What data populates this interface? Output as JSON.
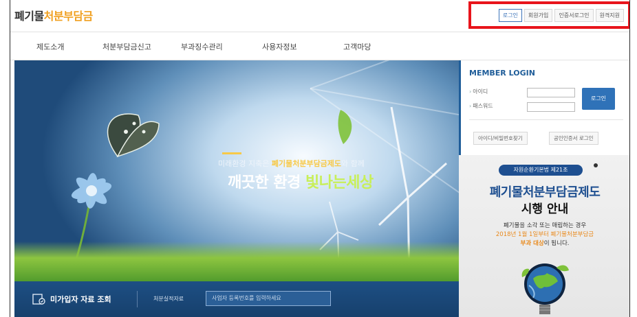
{
  "header": {
    "logo_part1": "폐기물",
    "logo_part2": "처분부담금"
  },
  "util_links": [
    "로그인",
    "회원가입",
    "인증서로그인",
    "원격지원"
  ],
  "nav": [
    "제도소개",
    "처분부담금신고",
    "부과징수관리",
    "사용자정보",
    "고객마당"
  ],
  "hero": {
    "line1_pre": "미래환경 지축은 ",
    "line1_highlight": "폐기물처분부담금제도",
    "line1_post": "와 함께",
    "line2_pre": "깨끗한 환경 ",
    "line2_highlight": "빛나는세상"
  },
  "lookup": {
    "title": "미가입자 자료 조회",
    "label": "처분실적자료",
    "placeholder": "사업자 등록번호를 입력하세요"
  },
  "login": {
    "title": "MEMBER LOGIN",
    "id_label": "아이디",
    "pw_label": "패스워드",
    "login_button": "로그인",
    "find_button": "아이디/비밀번호찾기",
    "cert_button": "공인인증서 로그인"
  },
  "promo": {
    "badge": "자원순환기본법 제21조",
    "title1": "폐기물처분부담금제도",
    "title2": "시행 안내",
    "line1": "폐기물을 소각 또는 매립하는 경우",
    "line2": "2018년 1월 1일부터 폐기물처분부담금",
    "line3_highlight": "부과 대상",
    "line3_rest": "이 됩니다."
  },
  "colors": {
    "brand_orange": "#f0a020",
    "brand_blue": "#1f5d99",
    "highlight_red": "#e8141b"
  }
}
